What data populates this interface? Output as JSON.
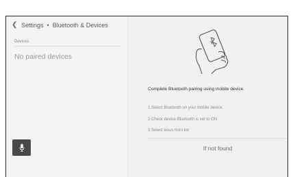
{
  "breadcrumb": {
    "back_icon": "chevron-left-icon",
    "parent": "Settings",
    "separator": "•",
    "current": "Bluetooth & Devices"
  },
  "devices": {
    "section_label": "Devices",
    "empty_message": "No paired devices"
  },
  "voice": {
    "icon": "microphone-icon"
  },
  "pairing": {
    "illustration_icon": "hand-holding-phone-bluetooth-icon",
    "title": "Complete Bluetooth pairing using mobile device.",
    "steps": [
      "1.Select Bluetooth on your mobile device",
      "2.Check device Bluetooth is set to ON",
      "3.Select lexus from list"
    ],
    "not_found_label": "If not found"
  },
  "colors": {
    "panel_bg": "#f4f4f4",
    "mic_button_bg": "#4a4a4a",
    "frame_border": "#2b2b2b"
  }
}
